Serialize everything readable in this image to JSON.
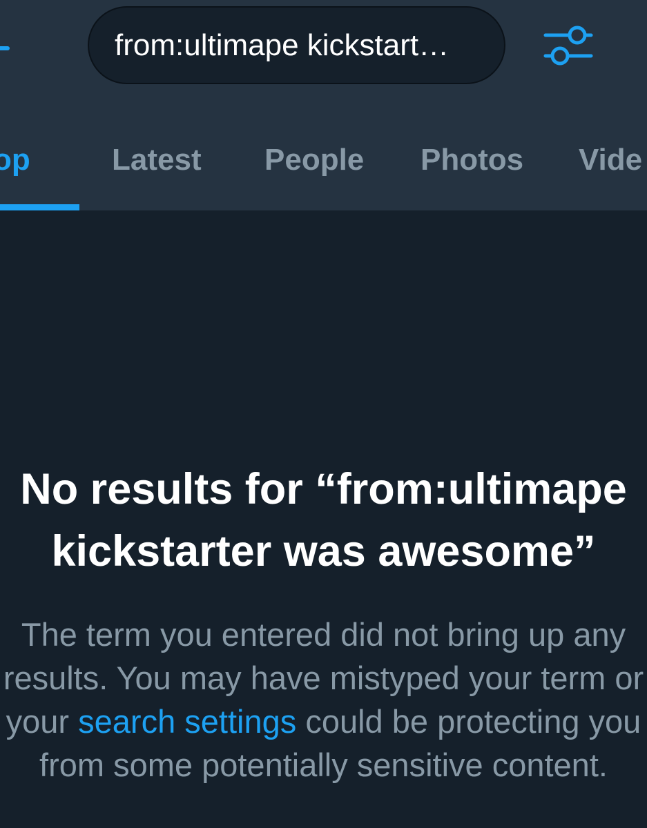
{
  "search": {
    "query": "from:ultimape kickstart…"
  },
  "icons": {
    "back": "back-arrow-icon",
    "filter": "filter-sliders-icon"
  },
  "colors": {
    "accent": "#1da1f2",
    "header_bg": "#253341",
    "page_bg": "#15202b",
    "muted_text": "#8899a6",
    "title_text": "#ffffff"
  },
  "tabs": [
    {
      "label": "Top",
      "visible_text": "op",
      "active": true
    },
    {
      "label": "Latest",
      "visible_text": "Latest",
      "active": false
    },
    {
      "label": "People",
      "visible_text": "People",
      "active": false
    },
    {
      "label": "Photos",
      "visible_text": "Photos",
      "active": false
    },
    {
      "label": "Videos",
      "visible_text": "Vide",
      "active": false
    }
  ],
  "empty_state": {
    "title_line1": "No results for “from:ultimape",
    "title_line2": "kickstarter was awesome”",
    "body_line1": "The term you entered did not bring up any",
    "body_line2": "results. You may have mistyped your term or",
    "body_line3_before": "your ",
    "body_link": "search settings",
    "body_line3_after": " could be protecting you",
    "body_line4": "from some potentially sensitive content."
  }
}
